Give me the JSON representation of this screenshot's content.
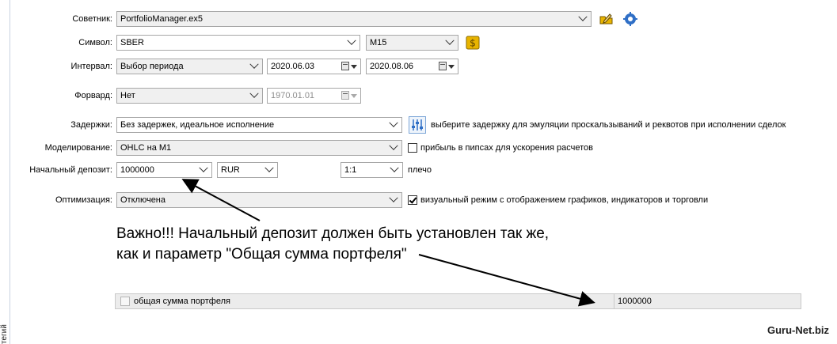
{
  "side_tab": "тегий",
  "fields": {
    "expert": {
      "label": "Советник:",
      "value": "PortfolioManager.ex5"
    },
    "symbol": {
      "label": "Символ:",
      "value": "SBER",
      "timeframe": "M15"
    },
    "interval": {
      "label": "Интервал:",
      "value": "Выбор периода",
      "from": "2020.06.03",
      "to": "2020.08.06"
    },
    "forward": {
      "label": "Форвард:",
      "value": "Нет",
      "date": "1970.01.01"
    },
    "delays": {
      "label": "Задержки:",
      "value": "Без задержек, идеальное исполнение",
      "hint": "выберите задержку для эмуляции проскальзываний и реквотов при исполнении сделок"
    },
    "modeling": {
      "label": "Моделирование:",
      "value": "OHLC на M1",
      "checkbox_label": "прибыль в пипсах для ускорения расчетов",
      "checkbox_checked": false
    },
    "deposit": {
      "label": "Начальный депозит:",
      "value": "1000000",
      "currency": "RUR",
      "leverage": "1:1",
      "leverage_label": "плечо"
    },
    "optimization": {
      "label": "Оптимизация:",
      "value": "Отключена",
      "checkbox_label": "визуальный режим с отображением графиков, индикаторов и торговли",
      "checkbox_checked": true
    }
  },
  "note": {
    "line1": "Важно!!! Начальный депозит должен быть установлен так же,",
    "line2": "как и параметр \"Общая сумма портфеля\""
  },
  "parameter_row": {
    "name": "общая сумма портфеля",
    "value": "1000000",
    "checked": false
  },
  "watermark": "Guru-Net.biz",
  "icons": {
    "edit": "pencil-folder-icon",
    "settings": "gear-icon",
    "symbol_props": "dollar-icon",
    "delay_settings": "sliders-icon"
  },
  "colors": {
    "accent_blue": "#2f6fc6",
    "gold": "#e8b400",
    "row_gray": "#ececec"
  }
}
